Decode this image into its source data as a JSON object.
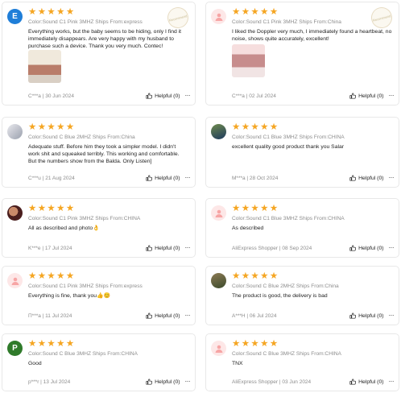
{
  "colors": {
    "star": "#f5a623",
    "meta": "#8c8c8c",
    "border": "#e8e8e8"
  },
  "reviews": [
    {
      "avatar": "E",
      "stars": "★★★★★",
      "variant": "Color:Sound C1 Pink 3MHZ Ships From:express",
      "text": "Everything works, but the baby seems to be hiding, only I find it immediately disappears. Are very happy with my husband to purchase such a device. Thank you very much. Contec!",
      "meta": "C***a | 30 Jun 2024",
      "helpful": "Helpful (0)",
      "stamp": "Recommend"
    },
    {
      "avatar": "",
      "stars": "★★★★★",
      "variant": "Color:Sound C1 Pink 3MHZ Ships From:China",
      "text": "I liked the Doppler very much, I immediately found a heartbeat, no noise, shows quite accurately, excellent!",
      "meta": "C***a | 02 Jul 2024",
      "helpful": "Helpful (0)",
      "stamp": "Recommend"
    },
    {
      "avatar": "",
      "stars": "★★★★★",
      "variant": "Color:Sound C Blue 2MHZ Ships From:China",
      "text": "Adequate stuff. Before him they took a simpler model. I didn't work shit and squeaked terribly. This working and comfortable. But the numbers show from the Balda. Only Listen]",
      "meta": "C***u | 21 Aug 2024",
      "helpful": "Helpful (0)"
    },
    {
      "avatar": "",
      "stars": "★★★★★",
      "variant": "Color:Sound C1 Blue 3MHZ Ships From:CHINA",
      "text": "excellent quality good product thank you Salar",
      "meta": "M***a | 28 Oct 2024",
      "helpful": "Helpful (0)"
    },
    {
      "avatar": "",
      "stars": "★★★★★",
      "variant": "Color:Sound C1 Pink 3MHZ Ships From:CHINA",
      "text": "All as described and photo👌",
      "meta": "K***e | 17 Jul 2024",
      "helpful": "Helpful (0)"
    },
    {
      "avatar": "",
      "stars": "★★★★★",
      "variant": "Color:Sound C1 Blue 3MHZ Ships From:CHINA",
      "text": "As described",
      "meta": "AliExpress Shopper | 08 Sep 2024",
      "helpful": "Helpful (0)"
    },
    {
      "avatar": "",
      "stars": "★★★★★",
      "variant": "Color:Sound C1 Pink 3MHZ Ships From:express",
      "text": "Everything is fine, thank you👍😊",
      "meta": "П***а | 11 Jul 2024",
      "helpful": "Helpful (0)"
    },
    {
      "avatar": "",
      "stars": "★★★★★",
      "variant": "Color:Sound C Blue 2MHZ Ships From:China",
      "text": "The product is good, the delivery is bad",
      "meta": "A***H | 06 Jul 2024",
      "helpful": "Helpful (0)"
    },
    {
      "avatar": "P",
      "stars": "★★★★★",
      "variant": "Color:Sound C Blue 3MHZ Ships From:CHINA",
      "text": "Good",
      "meta": "p***r | 13 Jul 2024",
      "helpful": "Helpful (0)"
    },
    {
      "avatar": "",
      "stars": "★★★★★",
      "variant": "Color:Sound C Blue 3MHZ Ships From:CHINA",
      "text": "TNX",
      "meta": "AliExpress Shopper | 03 Jun 2024",
      "helpful": "Helpful (0)"
    }
  ],
  "icons": {
    "helpful": "thumbs-up-icon",
    "more": "more-dots-icon",
    "person": "person-silhouette-icon"
  },
  "more_label": "···"
}
